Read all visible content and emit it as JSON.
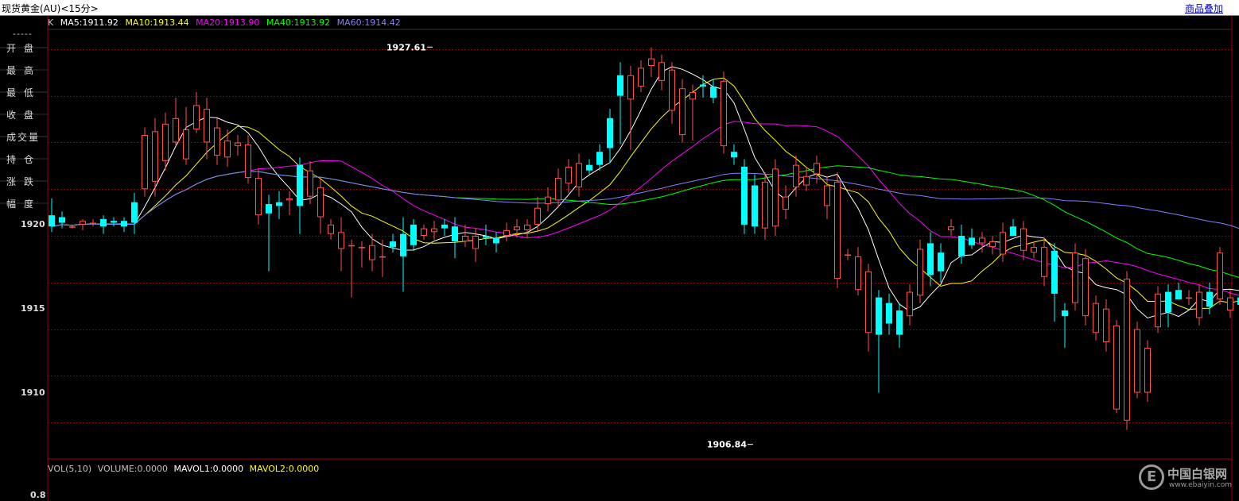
{
  "window": {
    "title": "现货黄金(AU)<15分>",
    "overlay_link": "商品叠加"
  },
  "sidebar": {
    "dash": "-----",
    "items": [
      "开盘",
      "最高",
      "最低",
      "收盘",
      "成交量",
      "持仓",
      "涨跌",
      "幅度"
    ]
  },
  "legend": {
    "k_label": "K",
    "ma": [
      {
        "label": "MA5:1911.92",
        "color": "#ffffff"
      },
      {
        "label": "MA10:1913.44",
        "color": "#ffff00"
      },
      {
        "label": "MA20:1913.90",
        "color": "#ff00ff"
      },
      {
        "label": "MA40:1913.92",
        "color": "#00ff00"
      },
      {
        "label": "MA60:1914.42",
        "color": "#8080ff"
      }
    ]
  },
  "volume": {
    "legend": [
      {
        "label": "VOL(5,10)",
        "color": "#c0c0c0"
      },
      {
        "label": "VOLUME:0.0000",
        "color": "#c0c0c0"
      },
      {
        "label": "MAVOL1:0.0000",
        "color": "#ffffff"
      },
      {
        "label": "MAVOL2:0.0000",
        "color": "#ffff00"
      }
    ],
    "tick": "0.8"
  },
  "watermark": {
    "title": "中国白银网",
    "url": "www.ebaiyin.com"
  },
  "colors": {
    "up": "#ff5050",
    "down": "#00ffff",
    "grid": "#8b0000",
    "frame": "#a00000"
  },
  "chart_data": {
    "type": "candlestick",
    "y_ticks": [
      1910,
      1915,
      1920
    ],
    "ylim": [
      1905.55,
      1929.28
    ],
    "annotations": {
      "high": {
        "label": "1927.61",
        "value": 1927.61,
        "index": 37
      },
      "low": {
        "label": "1906.84",
        "value": 1906.84,
        "index": 68
      }
    },
    "candles": [
      [
        1918.6,
        1918.0,
        1919.5,
        1917.7
      ],
      [
        1918.5,
        1918.2,
        1918.8,
        1917.9
      ],
      [
        1918.0,
        1918.0,
        1918.1,
        1917.9
      ],
      [
        1918.1,
        1918.3,
        1918.4,
        1917.8
      ],
      [
        1918.2,
        1918.2,
        1918.4,
        1918.0
      ],
      [
        1918.4,
        1918.0,
        1918.6,
        1917.6
      ],
      [
        1918.3,
        1918.2,
        1918.5,
        1918.0
      ],
      [
        1918.3,
        1918.0,
        1918.5,
        1917.7
      ],
      [
        1919.3,
        1918.2,
        1919.8,
        1917.6
      ],
      [
        1920.0,
        1922.9,
        1923.3,
        1919.6
      ],
      [
        1920.4,
        1923.1,
        1923.8,
        1919.6
      ],
      [
        1921.5,
        1923.5,
        1924.1,
        1921.0
      ],
      [
        1922.5,
        1923.8,
        1924.9,
        1922.3
      ],
      [
        1921.6,
        1923.2,
        1924.4,
        1921.3
      ],
      [
        1923.2,
        1924.5,
        1925.2,
        1923.0
      ],
      [
        1922.5,
        1924.3,
        1924.9,
        1921.6
      ],
      [
        1921.8,
        1923.3,
        1923.8,
        1921.3
      ],
      [
        1921.7,
        1922.6,
        1923.2,
        1921.2
      ],
      [
        1922.3,
        1922.5,
        1922.9,
        1921.8
      ],
      [
        1920.6,
        1922.4,
        1922.9,
        1920.3
      ],
      [
        1918.6,
        1920.6,
        1921.1,
        1918.1
      ],
      [
        1919.2,
        1918.7,
        1919.7,
        1915.6
      ],
      [
        1919.3,
        1919.1,
        1919.9,
        1918.4
      ],
      [
        1919.4,
        1919.5,
        1919.9,
        1918.6
      ],
      [
        1921.3,
        1919.1,
        1921.7,
        1917.6
      ],
      [
        1919.6,
        1921.0,
        1921.5,
        1919.2
      ],
      [
        1918.5,
        1920.1,
        1920.6,
        1917.6
      ],
      [
        1917.6,
        1918.1,
        1918.4,
        1917.3
      ],
      [
        1916.8,
        1917.7,
        1918.5,
        1915.6
      ],
      [
        1917.0,
        1917.0,
        1917.3,
        1914.2
      ],
      [
        1916.9,
        1916.9,
        1917.2,
        1915.8
      ],
      [
        1916.2,
        1917.0,
        1917.6,
        1915.6
      ],
      [
        1916.4,
        1916.4,
        1917.3,
        1915.3
      ],
      [
        1917.2,
        1916.9,
        1917.6,
        1916.6
      ],
      [
        1917.6,
        1916.4,
        1918.5,
        1914.5
      ],
      [
        1918.1,
        1917.0,
        1918.4,
        1916.7
      ],
      [
        1917.5,
        1917.9,
        1918.1,
        1917.3
      ],
      [
        1917.7,
        1917.9,
        1918.3,
        1917.3
      ],
      [
        1918.1,
        1917.9,
        1918.4,
        1917.5
      ],
      [
        1918.0,
        1917.2,
        1918.5,
        1916.3
      ],
      [
        1917.2,
        1917.5,
        1918.1,
        1916.9
      ],
      [
        1916.8,
        1917.5,
        1917.9,
        1916.1
      ],
      [
        1917.5,
        1917.4,
        1918.1,
        1917.0
      ],
      [
        1917.4,
        1917.1,
        1917.7,
        1916.6
      ],
      [
        1917.5,
        1917.8,
        1918.2,
        1917.2
      ],
      [
        1917.8,
        1918.0,
        1918.4,
        1917.4
      ],
      [
        1917.8,
        1918.1,
        1918.4,
        1917.4
      ],
      [
        1918.1,
        1919.0,
        1919.6,
        1917.7
      ],
      [
        1919.2,
        1919.6,
        1920.1,
        1918.8
      ],
      [
        1919.4,
        1920.6,
        1921.1,
        1919.0
      ],
      [
        1920.3,
        1921.2,
        1921.6,
        1919.8
      ],
      [
        1920.1,
        1921.4,
        1921.9,
        1919.6
      ],
      [
        1921.3,
        1921.0,
        1921.6,
        1920.8
      ],
      [
        1922.0,
        1921.3,
        1922.4,
        1921.0
      ],
      [
        1923.8,
        1922.2,
        1924.3,
        1921.4
      ],
      [
        1926.1,
        1925.0,
        1926.8,
        1922.4
      ],
      [
        1924.8,
        1926.1,
        1926.6,
        1922.1
      ],
      [
        1925.5,
        1926.5,
        1926.9,
        1925.2
      ],
      [
        1926.6,
        1927.0,
        1927.6,
        1926.0
      ],
      [
        1925.8,
        1926.8,
        1927.2,
        1925.3
      ],
      [
        1924.2,
        1926.4,
        1926.8,
        1923.5
      ],
      [
        1922.9,
        1925.4,
        1925.9,
        1922.5
      ],
      [
        1924.8,
        1925.2,
        1925.6,
        1922.6
      ],
      [
        1925.6,
        1925.5,
        1926.1,
        1924.9
      ],
      [
        1925.5,
        1924.9,
        1925.9,
        1924.6
      ],
      [
        1922.3,
        1925.8,
        1926.3,
        1921.9
      ],
      [
        1922.0,
        1921.7,
        1922.4,
        1921.3
      ],
      [
        1921.2,
        1918.1,
        1921.6,
        1917.6
      ],
      [
        1920.2,
        1918.0,
        1920.8,
        1917.6
      ],
      [
        1917.9,
        1920.4,
        1920.9,
        1917.3
      ],
      [
        1918.0,
        1921.1,
        1921.6,
        1917.5
      ],
      [
        1918.9,
        1919.6,
        1920.2,
        1918.4
      ],
      [
        1920.1,
        1921.3,
        1921.8,
        1919.6
      ],
      [
        1920.2,
        1920.7,
        1921.2,
        1919.9
      ],
      [
        1920.8,
        1921.4,
        1921.8,
        1920.3
      ],
      [
        1919.1,
        1920.2,
        1920.7,
        1918.4
      ],
      [
        1915.2,
        1920.4,
        1920.9,
        1914.7
      ],
      [
        1916.5,
        1916.5,
        1916.8,
        1916.2
      ],
      [
        1914.6,
        1916.4,
        1916.9,
        1914.3
      ],
      [
        1912.3,
        1915.6,
        1916.0,
        1911.3
      ],
      [
        1914.2,
        1912.2,
        1914.6,
        1909.1
      ],
      [
        1913.9,
        1912.8,
        1914.4,
        1912.2
      ],
      [
        1913.5,
        1912.2,
        1913.9,
        1911.5
      ],
      [
        1913.2,
        1914.5,
        1914.9,
        1912.7
      ],
      [
        1914.3,
        1916.8,
        1917.3,
        1913.9
      ],
      [
        1917.1,
        1915.4,
        1917.7,
        1914.8
      ],
      [
        1916.6,
        1915.6,
        1917.1,
        1915.0
      ],
      [
        1917.8,
        1918.0,
        1918.4,
        1917.5
      ],
      [
        1917.5,
        1916.4,
        1918.1,
        1916.0
      ],
      [
        1917.4,
        1917.0,
        1917.9,
        1916.8
      ],
      [
        1917.1,
        1917.4,
        1917.7,
        1916.6
      ],
      [
        1916.9,
        1917.2,
        1917.5,
        1916.5
      ],
      [
        1916.5,
        1917.7,
        1918.2,
        1916.1
      ],
      [
        1918.0,
        1917.5,
        1918.4,
        1917.5
      ],
      [
        1916.7,
        1917.9,
        1918.3,
        1916.2
      ],
      [
        1916.6,
        1916.9,
        1917.2,
        1916.3
      ],
      [
        1915.3,
        1916.9,
        1917.4,
        1914.8
      ],
      [
        1916.7,
        1914.4,
        1917.1,
        1912.9
      ],
      [
        1913.5,
        1913.2,
        1913.9,
        1911.5
      ],
      [
        1913.9,
        1916.6,
        1917.1,
        1913.5
      ],
      [
        1913.2,
        1916.3,
        1916.8,
        1912.7
      ],
      [
        1912.3,
        1913.9,
        1914.3,
        1911.9
      ],
      [
        1911.8,
        1913.6,
        1914.1,
        1911.3
      ],
      [
        1908.2,
        1912.7,
        1913.0,
        1908.0
      ],
      [
        1907.6,
        1915.2,
        1915.6,
        1907.1
      ],
      [
        1909.1,
        1912.5,
        1912.9,
        1908.8
      ],
      [
        1909.1,
        1911.5,
        1911.9,
        1908.6
      ],
      [
        1912.6,
        1914.4,
        1914.8,
        1912.3
      ],
      [
        1914.5,
        1913.4,
        1914.9,
        1912.6
      ],
      [
        1914.6,
        1914.1,
        1915.0,
        1914.1
      ],
      [
        1914.2,
        1914.2,
        1914.6,
        1913.8
      ],
      [
        1913.1,
        1914.5,
        1914.9,
        1912.7
      ],
      [
        1914.5,
        1913.7,
        1915.0,
        1913.3
      ],
      [
        1914.1,
        1916.6,
        1916.9,
        1913.8
      ],
      [
        1913.5,
        1914.2,
        1914.6,
        1913.1
      ],
      [
        1914.2,
        1913.8,
        1914.6,
        1913.5
      ],
      [
        1914.3,
        1913.2,
        1914.8,
        1912.6
      ],
      [
        1911.4,
        1913.6,
        1914.1,
        1911.0
      ],
      [
        1911.4,
        1910.3,
        1911.8,
        1909.9
      ],
      [
        1910.3,
        1911.4,
        1911.9,
        1909.6
      ],
      [
        1911.8,
        1911.7,
        1912.2,
        1911.5
      ],
      [
        1912.1,
        1912.0,
        1912.3,
        1911.8
      ],
      [
        1912.4,
        1912.1,
        1912.7,
        1911.7
      ],
      [
        1913.1,
        1913.4,
        1913.8,
        1912.8
      ],
      [
        1913.7,
        1914.2,
        1914.6,
        1913.3
      ],
      [
        1914.1,
        1915.2,
        1915.5,
        1913.8
      ],
      [
        1915.2,
        1915.5,
        1915.9,
        1914.9
      ],
      [
        1915.9,
        1916.4,
        1916.9,
        1915.4
      ],
      [
        1916.2,
        1917.3,
        1917.9,
        1915.8
      ],
      [
        1916.5,
        1917.0,
        1917.5,
        1916.1
      ],
      [
        1915.3,
        1917.0,
        1917.4,
        1914.8
      ],
      [
        1915.6,
        1915.8,
        1916.1,
        1915.2
      ],
      [
        1915.6,
        1915.7,
        1916.1,
        1915.3
      ],
      [
        1915.2,
        1915.3,
        1915.6,
        1914.9
      ],
      [
        1914.4,
        1915.5,
        1915.9,
        1913.9
      ],
      [
        1913.9,
        1915.2,
        1915.6,
        1913.4
      ],
      [
        1914.1,
        1914.2,
        1914.6,
        1913.7
      ],
      [
        1913.6,
        1914.2,
        1914.7,
        1913.2
      ],
      [
        1913.9,
        1913.8,
        1914.2,
        1913.6
      ],
      [
        1913.5,
        1913.8,
        1914.1,
        1913.1
      ],
      [
        1913.2,
        1913.7,
        1914.1,
        1912.9
      ],
      [
        1913.7,
        1913.4,
        1914.0,
        1913.3
      ],
      [
        1913.6,
        1913.6,
        1913.8,
        1913.4
      ],
      [
        1913.6,
        1913.6,
        1913.8,
        1913.4
      ],
      [
        1914.2,
        1915.3,
        1915.6,
        1913.8
      ],
      [
        1915.1,
        1915.2,
        1915.5,
        1914.6
      ],
      [
        1915.3,
        1915.1,
        1915.7,
        1914.6
      ],
      [
        1914.5,
        1914.3,
        1914.9,
        1914.1
      ],
      [
        1915.2,
        1916.4,
        1916.8,
        1914.8
      ],
      [
        1915.4,
        1916.0,
        1916.3,
        1915.1
      ],
      [
        1914.7,
        1916.0,
        1916.3,
        1914.3
      ],
      [
        1913.9,
        1915.2,
        1915.6,
        1913.5
      ],
      [
        1912.3,
        1913.6,
        1914.0,
        1911.8
      ],
      [
        1911.6,
        1912.6,
        1913.1,
        1911.2
      ],
      [
        1911.8,
        1913.4,
        1913.8,
        1911.4
      ],
      [
        1910.9,
        1913.3,
        1913.8,
        1910.5
      ],
      [
        1910.3,
        1912.4,
        1912.9,
        1909.8
      ],
      [
        1911.9,
        1911.1,
        1912.3,
        1910.6
      ],
      [
        1910.9,
        1911.0,
        1911.3,
        1909.9
      ]
    ]
  }
}
